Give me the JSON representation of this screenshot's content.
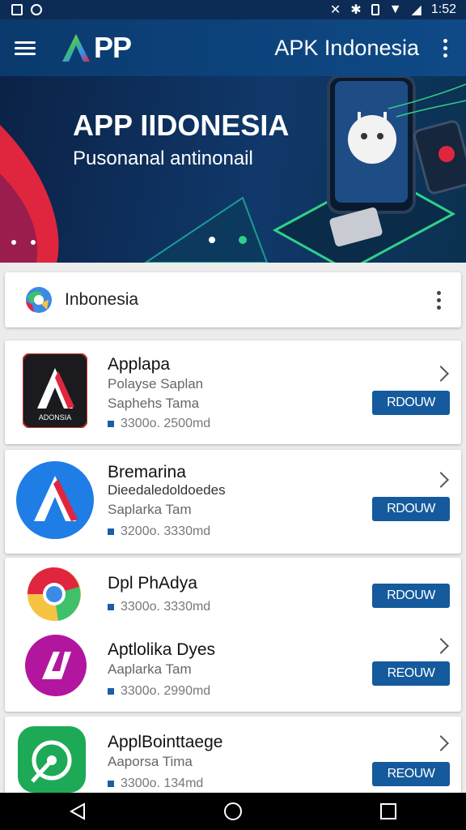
{
  "status_bar": {
    "time": "1:52"
  },
  "app_bar": {
    "logo_text": "PP",
    "title": "APK Indonesia"
  },
  "banner": {
    "title": "APP IIDONESIA",
    "subtitle": "Pusonanal antinonail"
  },
  "section": {
    "title": "Inbonesia"
  },
  "apps": [
    {
      "name": "Applapa",
      "subtitle": "Polayse Saplan",
      "developer": "Saphehs Tama",
      "meta": "3300o. 2500md",
      "button": "RDOUW",
      "icon_label": "ADONSIA"
    },
    {
      "name": "Bremarina",
      "subtitle": "Dieedaledoldoedes",
      "developer": "Saplarka Tam",
      "meta": "3200o. 3330md",
      "button": "RDOUW"
    },
    {
      "name": "Dpl PhAdya",
      "meta": "3300o. 3330md",
      "button": "RDOUW"
    },
    {
      "name": "Aptlolika Dyes",
      "developer": "Aaplarka Tam",
      "meta": "3300o. 2990md",
      "button": "REOUW"
    },
    {
      "name": "ApplBointtaege",
      "developer": "Aaporsa Tima",
      "meta": "3300o. 134md",
      "button": "REOUW"
    }
  ],
  "colors": {
    "primary": "#0f4a87",
    "button": "#145a9c",
    "accent_red": "#e0263f"
  },
  "icons": [
    "menu-icon",
    "more-vert-icon",
    "globe-icon",
    "chevron-right-icon",
    "back-icon",
    "home-icon",
    "recents-icon"
  ]
}
